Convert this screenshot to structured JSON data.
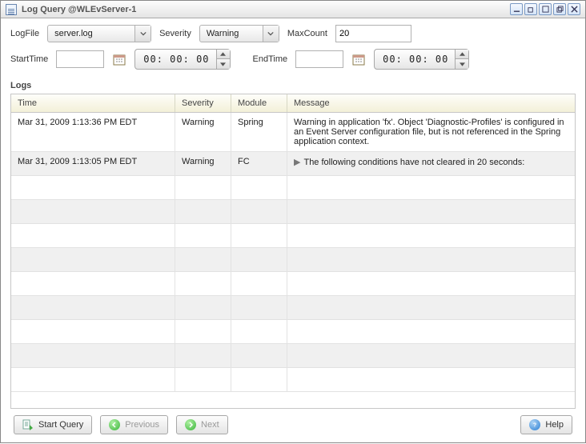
{
  "window": {
    "title": "Log Query @WLEvServer-1"
  },
  "form": {
    "logfile_label": "LogFile",
    "logfile_value": "server.log",
    "severity_label": "Severity",
    "severity_value": "Warning",
    "maxcount_label": "MaxCount",
    "maxcount_value": "20",
    "starttime_label": "StartTime",
    "starttime_value": "",
    "starttime_time": "00: 00: 00",
    "endtime_label": "EndTime",
    "endtime_value": "",
    "endtime_time": "00: 00: 00"
  },
  "logs_section_title": "Logs",
  "grid": {
    "columns": {
      "time": "Time",
      "severity": "Severity",
      "module": "Module",
      "message": "Message"
    },
    "rows": [
      {
        "time": "Mar 31, 2009 1:13:36 PM EDT",
        "severity": "Warning",
        "module": "Spring",
        "message": "Warning in application 'fx'.  Object 'Diagnostic-Profiles' is configured in an Event Server configuration file, but is not referenced in the Spring application context."
      },
      {
        "time": "Mar 31, 2009 1:13:05 PM EDT",
        "severity": "Warning",
        "module": "FC",
        "message": "The following conditions have not cleared in 20 seconds:",
        "expandable": true
      }
    ],
    "empty_rows": 9
  },
  "buttons": {
    "start_query": "Start Query",
    "previous": "Previous",
    "next": "Next",
    "help": "Help"
  }
}
